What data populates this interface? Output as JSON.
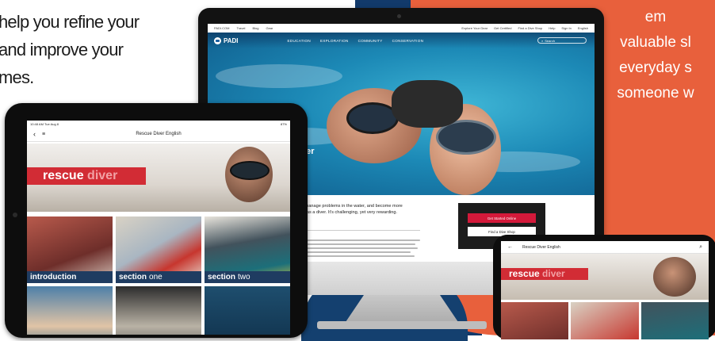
{
  "marketing": {
    "left_lines": [
      "help you refine your",
      "and improve your",
      "mes."
    ],
    "right_lines": [
      "em",
      "valuable sl",
      "everyday s",
      "someone w"
    ]
  },
  "desktop": {
    "utility_left": [
      "PADI.COM",
      "Travel",
      "Blog",
      "Gear"
    ],
    "utility_right": [
      "Explore Your Gear",
      "Get Certified",
      "Find a Dive Shop",
      "Help",
      "Sign In",
      "English"
    ],
    "logo_text": "PADI",
    "nav_links": [
      "EDUCATION",
      "EXPLORATION",
      "COMMUNITY",
      "CONSERVATION"
    ],
    "search_placeholder": "Search",
    "hero_title": "ver",
    "lead_lines": [
      "d manage problems in the water, and become more",
      "lls as a diver. It's challenging, yet very rewarding."
    ],
    "cta_primary": "Get Started Online",
    "cta_secondary": "Find a Dive Shop"
  },
  "tablet": {
    "status_left": "10:48 AM   Tue Aug 8",
    "status_right": "87%",
    "app_title": "Rescue Diver English",
    "banner_word1": "rescue",
    "banner_word2": "diver",
    "tiles": [
      {
        "bold": "introduction",
        "thin": ""
      },
      {
        "bold": "section",
        "thin": "one"
      },
      {
        "bold": "section",
        "thin": "two"
      }
    ]
  },
  "phone": {
    "app_title": "Rescue Diver English",
    "banner_word1": "rescue",
    "banner_word2": "diver"
  },
  "colors": {
    "orange": "#e8603c",
    "navy": "#123a6b",
    "padi_red": "#d3193a",
    "tile_caption": "#1f3c61"
  }
}
